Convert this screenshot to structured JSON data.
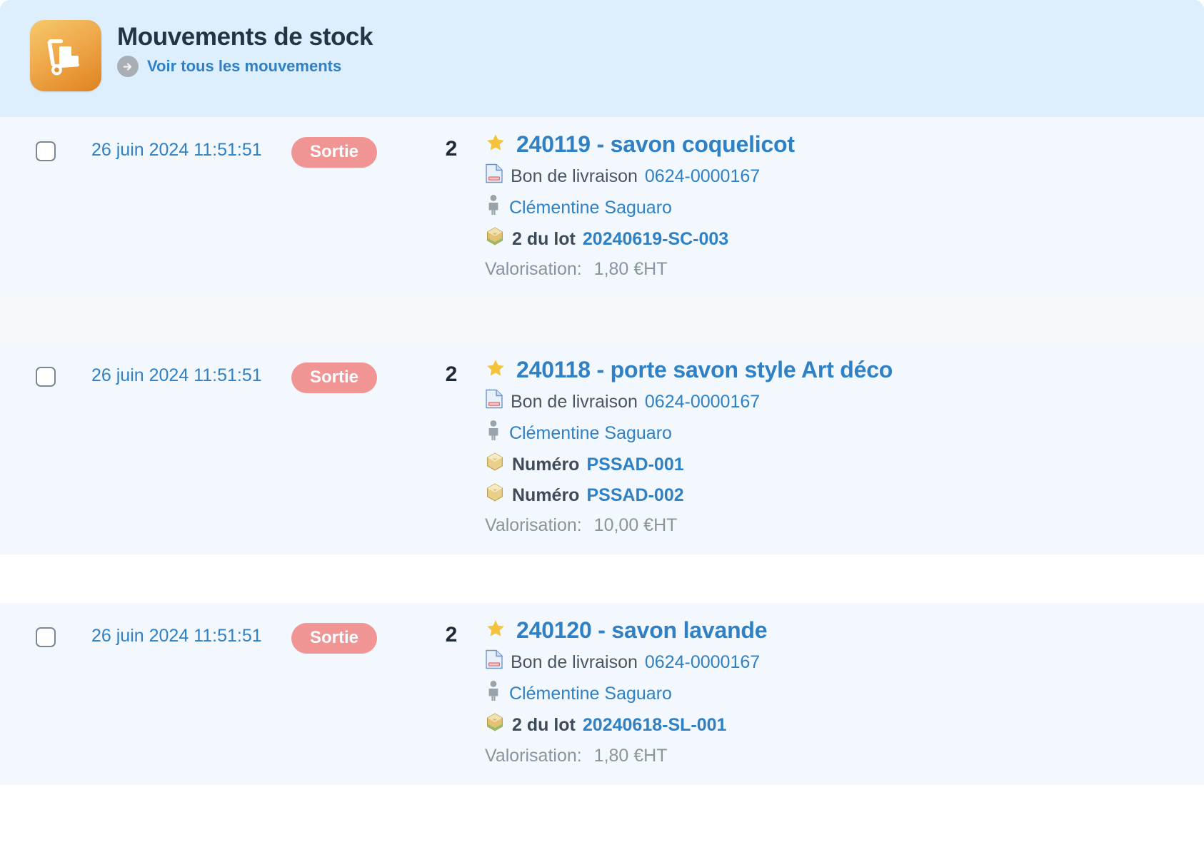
{
  "header": {
    "icon": "hand-truck-icon",
    "title": "Mouvements de stock",
    "link_label": "Voir tous les mouvements",
    "link_icon": "arrow-right-circle-icon",
    "bg_color": "#ddeefc",
    "icon_color": "#e89a35"
  },
  "labels": {
    "valorisation": "Valorisation:",
    "delivery_note": "Bon de livraison",
    "lot_prefix": "du lot",
    "serial_prefix": "Numéro"
  },
  "rows": [
    {
      "checkbox_checked": false,
      "date": "26 juin 2024 11:51:51",
      "badge": "Sortie",
      "badge_color": "#f19494",
      "quantity": "2",
      "favorite_icon": "star-icon",
      "product": "240119 - savon coquelicot",
      "document_icon": "document-icon",
      "document_label": "Bon de livraison",
      "document_ref": "0624-0000167",
      "user_icon": "person-icon",
      "user": "Clémentine Saguaro",
      "batches": [
        {
          "icon": "lot-box-icon",
          "label": "2 du lot",
          "value": "20240619-SC-003"
        }
      ],
      "valorisation_label": "Valorisation:",
      "valorisation_value": "1,80 €HT"
    },
    {
      "checkbox_checked": false,
      "date": "26 juin 2024 11:51:51",
      "badge": "Sortie",
      "badge_color": "#f19494",
      "quantity": "2",
      "favorite_icon": "star-icon",
      "product": "240118 - porte savon style Art déco",
      "document_icon": "document-icon",
      "document_label": "Bon de livraison",
      "document_ref": "0624-0000167",
      "user_icon": "person-icon",
      "user": "Clémentine Saguaro",
      "batches": [
        {
          "icon": "serial-box-icon",
          "label": "Numéro",
          "value": "PSSAD-001"
        },
        {
          "icon": "serial-box-icon",
          "label": "Numéro",
          "value": "PSSAD-002"
        }
      ],
      "valorisation_label": "Valorisation:",
      "valorisation_value": "10,00 €HT"
    },
    {
      "checkbox_checked": false,
      "date": "26 juin 2024 11:51:51",
      "badge": "Sortie",
      "badge_color": "#f19494",
      "quantity": "2",
      "favorite_icon": "star-icon",
      "product": "240120 - savon lavande",
      "document_icon": "document-icon",
      "document_label": "Bon de livraison",
      "document_ref": "0624-0000167",
      "user_icon": "person-icon",
      "user": "Clémentine Saguaro",
      "batches": [
        {
          "icon": "lot-box-icon",
          "label": "2 du lot",
          "value": "20240618-SL-001"
        }
      ],
      "valorisation_label": "Valorisation:",
      "valorisation_value": "1,80 €HT"
    }
  ]
}
